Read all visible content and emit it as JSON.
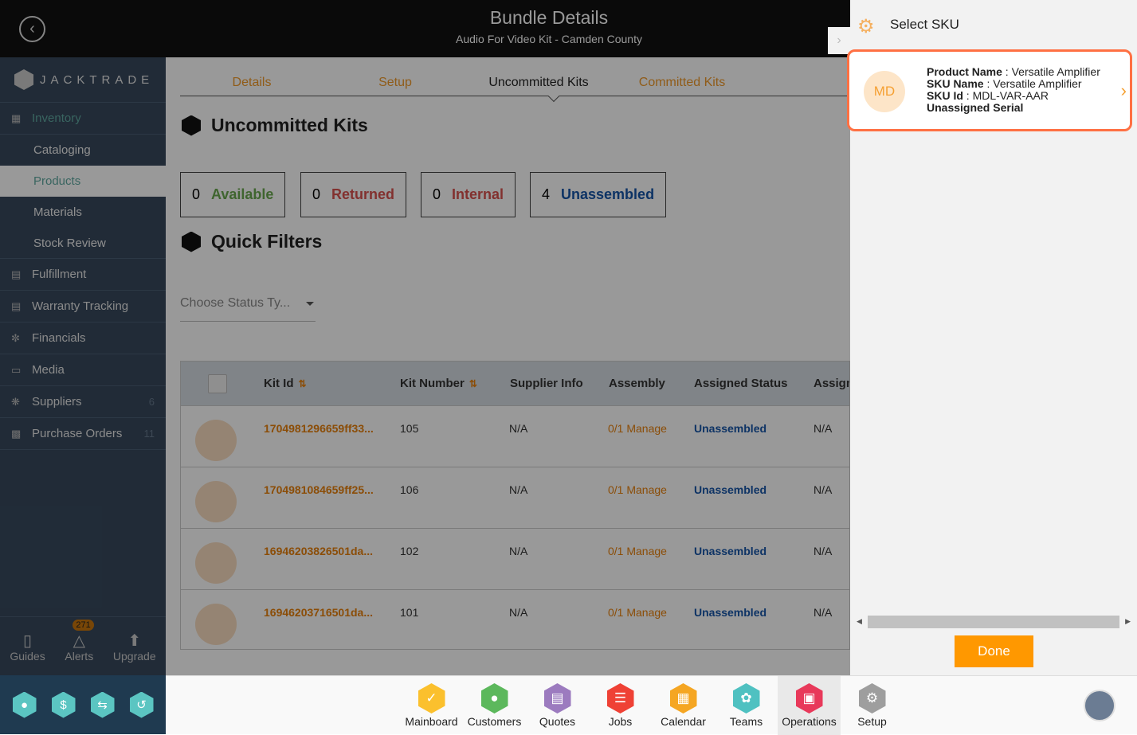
{
  "header": {
    "title": "Bundle Details",
    "subtitle": "Audio For Video Kit - Camden County",
    "back_icon": "arrow-left-circle"
  },
  "sidebar": {
    "logo": "JACKTRADE",
    "items": [
      {
        "label": "Inventory",
        "icon": "inventory-icon",
        "active": true,
        "children": [
          {
            "label": "Cataloging"
          },
          {
            "label": "Products",
            "active": true
          },
          {
            "label": "Materials"
          },
          {
            "label": "Stock Review"
          }
        ]
      },
      {
        "label": "Fulfillment",
        "icon": "fulfillment-icon"
      },
      {
        "label": "Warranty Tracking",
        "icon": "warranty-icon"
      },
      {
        "label": "Financials",
        "icon": "financials-icon"
      },
      {
        "label": "Media",
        "icon": "media-icon"
      },
      {
        "label": "Suppliers",
        "icon": "suppliers-icon",
        "count": "6"
      },
      {
        "label": "Purchase Orders",
        "icon": "purchase-orders-icon",
        "count": "11"
      }
    ],
    "bottom": [
      {
        "label": "Guides"
      },
      {
        "label": "Alerts",
        "badge": "271"
      },
      {
        "label": "Upgrade"
      }
    ]
  },
  "main": {
    "tabs": [
      {
        "label": "Details"
      },
      {
        "label": "Setup"
      },
      {
        "label": "Uncommitted Kits",
        "selected": true
      },
      {
        "label": "Committed Kits"
      }
    ],
    "section_title": "Uncommitted Kits",
    "stats": [
      {
        "count": "0",
        "label": "Available",
        "color": "#6aa84f"
      },
      {
        "count": "0",
        "label": "Returned",
        "color": "#d9534f"
      },
      {
        "count": "0",
        "label": "Internal",
        "color": "#d9534f"
      },
      {
        "count": "4",
        "label": "Unassembled",
        "color": "#1655a8"
      }
    ],
    "filters_title": "Quick Filters",
    "status_placeholder": "Choose Status Ty...",
    "table": {
      "columns": [
        "Kit Id",
        "Kit Number",
        "Supplier Info",
        "Assembly",
        "Assigned Status",
        "Assign"
      ],
      "rows": [
        {
          "kit_id": "1704981296659ff33...",
          "kit_number": "105",
          "supplier": "N/A",
          "assembly": "0/1 Manage",
          "status": "Unassembled",
          "assign": "N/A"
        },
        {
          "kit_id": "1704981084659ff25...",
          "kit_number": "106",
          "supplier": "N/A",
          "assembly": "0/1 Manage",
          "status": "Unassembled",
          "assign": "N/A"
        },
        {
          "kit_id": "16946203826501da...",
          "kit_number": "102",
          "supplier": "N/A",
          "assembly": "0/1 Manage",
          "status": "Unassembled",
          "assign": "N/A"
        },
        {
          "kit_id": "16946203716501da...",
          "kit_number": "101",
          "supplier": "N/A",
          "assembly": "0/1 Manage",
          "status": "Unassembled",
          "assign": "N/A"
        }
      ]
    }
  },
  "panel": {
    "title": "Select SKU",
    "card": {
      "initials": "MD",
      "product_label": "Product Name",
      "product_value": "Versatile Amplifier",
      "sku_name_label": "SKU Name",
      "sku_name_value": "Versatile Amplifier",
      "sku_id_label": "SKU Id",
      "sku_id_value": "MDL-VAR-AAR",
      "serial": "Unassigned Serial"
    },
    "done_label": "Done",
    "accent": "#ff9800"
  },
  "bottom_nav": [
    {
      "label": "Mainboard",
      "color": "#fbc02d"
    },
    {
      "label": "Customers",
      "color": "#5cb85c"
    },
    {
      "label": "Quotes",
      "color": "#9c7bbf"
    },
    {
      "label": "Jobs",
      "color": "#ef4135"
    },
    {
      "label": "Calendar",
      "color": "#f5a623"
    },
    {
      "label": "Teams",
      "color": "#4fc1c1"
    },
    {
      "label": "Operations",
      "color": "#e8395a",
      "selected": true
    },
    {
      "label": "Setup",
      "color": "#9e9e9e"
    }
  ]
}
